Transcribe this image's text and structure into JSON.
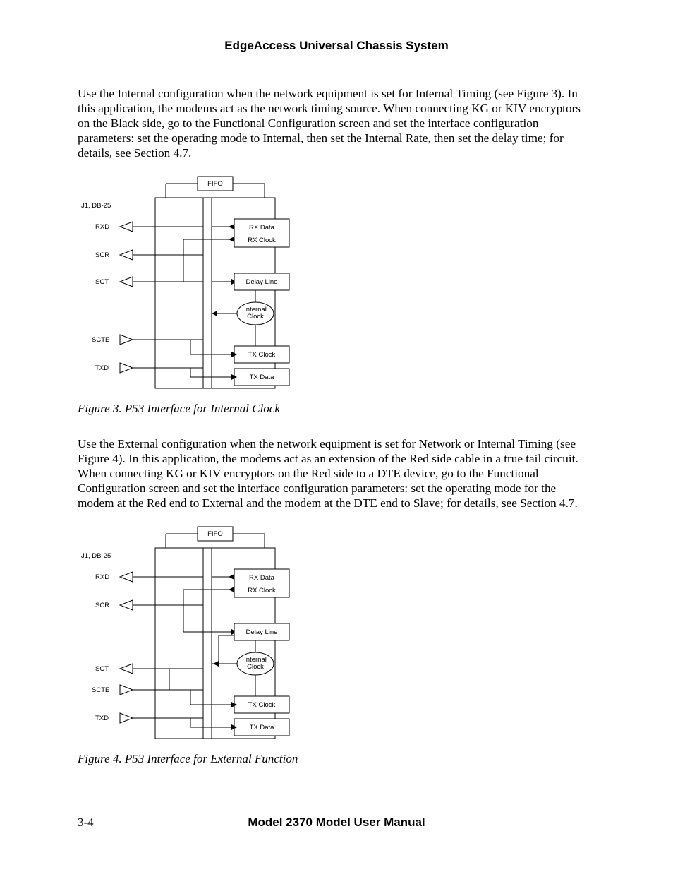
{
  "header": "EdgeAccess Universal Chassis System",
  "para1": "Use the Internal configuration when the network equipment is set for Internal Timing (see Figure 3).  In this application, the modems act as the network timing source.  When connecting KG or KIV encryptors on the Black side, go to the Functional Configuration screen and set the interface configuration parameters:  set the operating mode to Internal, then set the Internal Rate, then set the delay time; for details, see Section 4.7.",
  "fig3_caption": "Figure 3.  P53 Interface for Internal Clock",
  "para2": "Use the External configuration when the network equipment is set for Network or Internal Timing (see Figure 4).  In this application, the modems act as an extension of the Red side cable in a true tail circuit.  When connecting KG or KIV encryptors on the Red side to a DTE device, go to the Functional Configuration screen and set the interface configuration parameters:  set the operating mode for the modem at the Red end to External and the modem at the DTE end to Slave; for details, see Section 4.7.",
  "fig4_caption": "Figure 4.  P53 Interface for External Function",
  "footer": {
    "page": "3-4",
    "title": "Model 2370 Model User Manual"
  },
  "diagram": {
    "top_label": "J1, DB-25",
    "fifo": "FIFO",
    "left_signals": [
      "RXD",
      "SCR",
      "SCT",
      "SCTE",
      "TXD"
    ],
    "right_blocks": {
      "rx_data": "RX Data",
      "rx_clock": "RX Clock",
      "delay_line": "Delay Line",
      "internal_clock": "Internal\nClock",
      "tx_clock": "TX Clock",
      "tx_data": "TX Data"
    }
  },
  "diagram2": {
    "top_label": "J1, DB-25",
    "fifo": "FIFO",
    "left_signals_ext": [
      "RXD",
      "SCR",
      "SCT",
      "SCTE",
      "TXD"
    ],
    "right_blocks": {
      "rx_data": "RX Data",
      "rx_clock": "RX Clock",
      "delay_line": "Delay Line",
      "internal_clock": "Internal\nClock",
      "tx_clock": "TX Clock",
      "tx_data": "TX Data"
    }
  }
}
